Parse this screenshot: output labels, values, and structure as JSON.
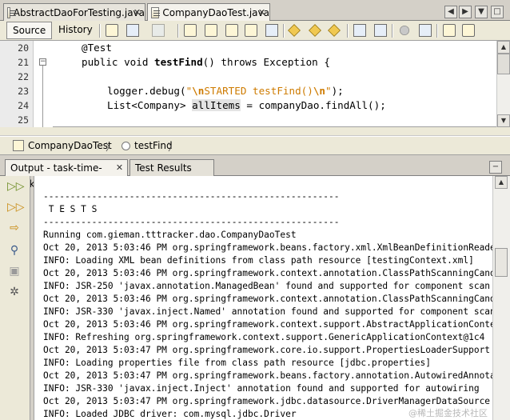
{
  "file_tabs": [
    {
      "label": "AbstractDaoForTesting.java",
      "active": false
    },
    {
      "label": "CompanyDaoTest.java",
      "active": true
    }
  ],
  "toolbar": {
    "source_label": "Source",
    "history_label": "History"
  },
  "editor": {
    "lines": [
      {
        "num": "20",
        "text": "@Test"
      },
      {
        "num": "21",
        "text": "public void testFind() throws Exception {"
      },
      {
        "num": "22",
        "text": ""
      },
      {
        "num": "23",
        "text": "logger.debug(\"\\nSTARTED testFind()\\n\");"
      },
      {
        "num": "24",
        "text": "List<Company> allItems = companyDao.findAll();"
      },
      {
        "num": "25",
        "text": ""
      }
    ]
  },
  "breadcrumb": {
    "class_name": "CompanyDaoTest",
    "method_name": "testFind"
  },
  "output_tabs": [
    {
      "label": "Output - task-time-tracker",
      "active": true
    },
    {
      "label": "Test Results",
      "active": false
    }
  ],
  "output_lines": [
    "-------------------------------------------------------",
    " T E S T S",
    "-------------------------------------------------------",
    "Running com.gieman.tttracker.dao.CompanyDaoTest",
    "Oct 20, 2013 5:03:46 PM org.springframework.beans.factory.xml.XmlBeanDefinitionReader",
    "INFO: Loading XML bean definitions from class path resource [testingContext.xml]",
    "Oct 20, 2013 5:03:46 PM org.springframework.context.annotation.ClassPathScanningCandid",
    "INFO: JSR-250 'javax.annotation.ManagedBean' found and supported for component scan",
    "Oct 20, 2013 5:03:46 PM org.springframework.context.annotation.ClassPathScanningCandid",
    "INFO: JSR-330 'javax.inject.Named' annotation found and supported for component scan",
    "Oct 20, 2013 5:03:46 PM org.springframework.context.support.AbstractApplicationContext",
    "INFO: Refreshing org.springframework.context.support.GenericApplicationContext@1c4",
    "Oct 20, 2013 5:03:47 PM org.springframework.core.io.support.PropertiesLoaderSupport",
    "INFO: Loading properties file from class path resource [jdbc.properties]",
    "Oct 20, 2013 5:03:47 PM org.springframework.beans.factory.annotation.AutowiredAnnotat",
    "INFO: JSR-330 'javax.inject.Inject' annotation found and supported for autowiring",
    "Oct 20, 2013 5:03:47 PM org.springframework.jdbc.datasource.DriverManagerDataSource",
    "INFO: Loaded JDBC driver: com.mysql.jdbc.Driver"
  ],
  "watermark": "@稀土掘金技术社区"
}
